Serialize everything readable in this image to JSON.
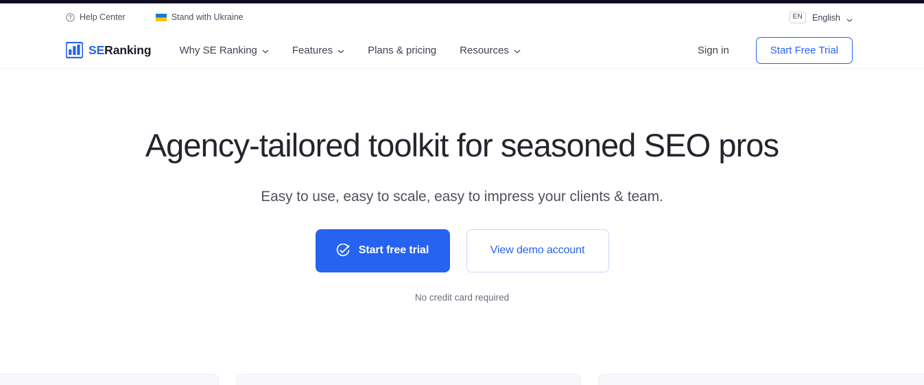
{
  "brand": {
    "accent": "#2563f0",
    "dark": "#23252e",
    "logo_se": "SE",
    "logo_ranking": "Ranking",
    "logo_icon": "bar-chart-logo-icon"
  },
  "utility_bar": {
    "links": [
      {
        "label": "Help Center",
        "icon": "question-circle-icon"
      },
      {
        "label": "Stand with Ukraine",
        "icon": "ukraine-flag-icon"
      }
    ],
    "language": {
      "code": "EN",
      "name": "English",
      "chevron_icon": "chevron-down-icon"
    }
  },
  "header": {
    "nav": [
      {
        "label": "Why SE Ranking",
        "has_chevron": true
      },
      {
        "label": "Features",
        "has_chevron": true
      },
      {
        "label": "Plans & pricing",
        "has_chevron": false
      },
      {
        "label": "Resources",
        "has_chevron": true
      }
    ],
    "sign_in": "Sign in",
    "cta": "Start Free Trial"
  },
  "hero": {
    "title": "Agency-tailored toolkit for seasoned SEO pros",
    "subtitle": "Easy to use, easy to scale, easy to impress your clients & team.",
    "primary_cta": {
      "label": "Start free trial",
      "icon": "check-circle-icon"
    },
    "secondary_cta": {
      "label": "View demo account"
    },
    "note": "No credit card required"
  },
  "cards_preview": {
    "count": 3,
    "fill": "#f7f8fb"
  }
}
